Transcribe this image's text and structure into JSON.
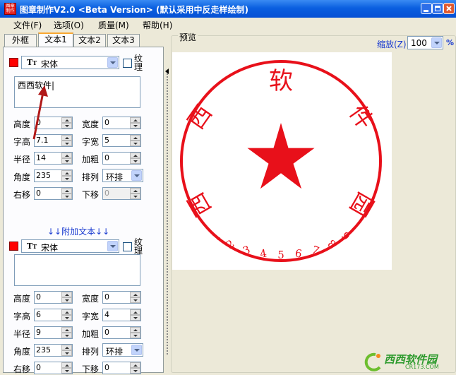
{
  "window": {
    "title": "图章制作V2.0 <Beta Version> (默认采用中反走样绘制)",
    "icon_text": "图章制作"
  },
  "menu": [
    {
      "label": "文件(F)"
    },
    {
      "label": "选项(O)"
    },
    {
      "label": "质量(M)"
    },
    {
      "label": "帮助(H)"
    }
  ],
  "tabs": [
    {
      "label": "外框"
    },
    {
      "label": "文本1"
    },
    {
      "label": "文本2"
    },
    {
      "label": "文本3"
    }
  ],
  "text1": {
    "color": "#FF0000",
    "font": "宋体",
    "texture_label": "纹理",
    "text_value": "西西软件|",
    "fields": {
      "height": {
        "label": "高度",
        "value": "0"
      },
      "width": {
        "label": "宽度",
        "value": "0"
      },
      "char_height": {
        "label": "字高",
        "value": "7.1"
      },
      "char_width": {
        "label": "字宽",
        "value": "5"
      },
      "radius": {
        "label": "半径",
        "value": "14"
      },
      "bold": {
        "label": "加粗",
        "value": "0"
      },
      "angle": {
        "label": "角度",
        "value": "235"
      },
      "layout": {
        "label": "排列",
        "value": "环排"
      },
      "shift_right": {
        "label": "右移",
        "value": "0"
      },
      "shift_down": {
        "label": "下移",
        "value": "0"
      }
    }
  },
  "add_text_label": "↓↓附加文本↓↓",
  "text_extra": {
    "color": "#FF0000",
    "font": "宋体",
    "texture_label": "纹理",
    "text_value": "",
    "fields": {
      "height": {
        "label": "高度",
        "value": "0"
      },
      "width": {
        "label": "宽度",
        "value": "0"
      },
      "char_height": {
        "label": "字高",
        "value": "6"
      },
      "char_width": {
        "label": "字宽",
        "value": "4"
      },
      "radius": {
        "label": "半径",
        "value": "9"
      },
      "bold": {
        "label": "加粗",
        "value": "0"
      },
      "angle": {
        "label": "角度",
        "value": "235"
      },
      "layout": {
        "label": "排列",
        "value": "环排"
      },
      "shift_right": {
        "label": "右移",
        "value": "0"
      },
      "shift_down": {
        "label": "下移",
        "value": "0"
      }
    }
  },
  "preview": {
    "label": "预览",
    "zoom_label": "缩放(Z)",
    "zoom_value": "100",
    "zoom_unit": "%",
    "stamp_color": "#E8101A",
    "main_chars": [
      "西",
      "西",
      "软",
      "件",
      "园"
    ],
    "digits": [
      "1",
      "2",
      "3",
      "4",
      "5",
      "6",
      "7",
      "8",
      "9"
    ]
  },
  "watermark": {
    "brand": "西西软件园",
    "url": "CR173.COM"
  }
}
